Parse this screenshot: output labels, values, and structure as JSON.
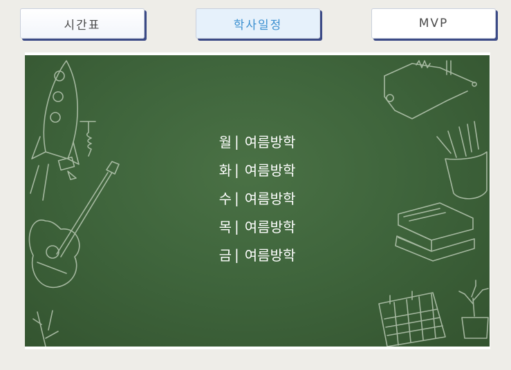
{
  "tabs": [
    {
      "label": "시간표"
    },
    {
      "label": "학사일정"
    },
    {
      "label": "MVP"
    }
  ],
  "schedule": [
    {
      "day": "월",
      "sep": "|",
      "event": "여름방학"
    },
    {
      "day": "화",
      "sep": "|",
      "event": "여름방학"
    },
    {
      "day": "수",
      "sep": "|",
      "event": "여름방학"
    },
    {
      "day": "목",
      "sep": "|",
      "event": "여름방학"
    },
    {
      "day": "금",
      "sep": "|",
      "event": "여름방학"
    }
  ],
  "colors": {
    "background": "#eeede8",
    "board": "#3f653c",
    "active_tab_text": "#3a8fd0",
    "tab_shadow": "#3b4a86"
  }
}
